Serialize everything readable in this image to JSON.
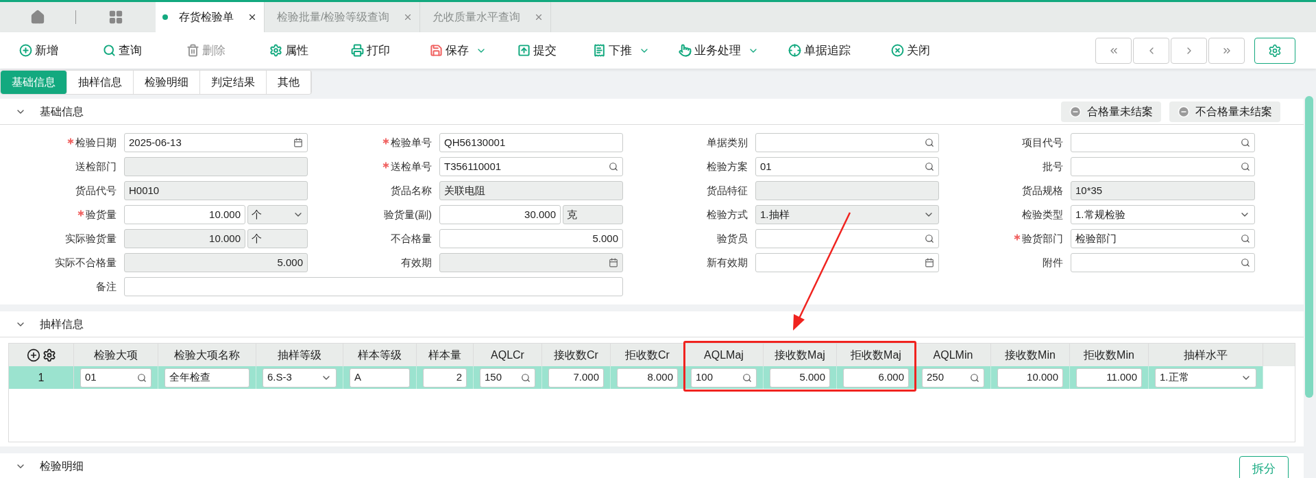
{
  "tabs": [
    {
      "label": "存货检验单",
      "selected": true
    },
    {
      "label": "检验批量/检验等级查询",
      "selected": false
    },
    {
      "label": "允收质量水平查询",
      "selected": false
    }
  ],
  "toolbar": [
    {
      "label": "新增",
      "disabled": false,
      "dropdown": false
    },
    {
      "label": "查询",
      "disabled": false,
      "dropdown": false
    },
    {
      "label": "删除",
      "disabled": true,
      "dropdown": false
    },
    {
      "label": "属性",
      "disabled": false,
      "dropdown": false
    },
    {
      "label": "打印",
      "disabled": false,
      "dropdown": false
    },
    {
      "label": "保存",
      "disabled": false,
      "dropdown": true
    },
    {
      "label": "提交",
      "disabled": false,
      "dropdown": false
    },
    {
      "label": "下推",
      "disabled": false,
      "dropdown": true
    },
    {
      "label": "业务处理",
      "disabled": false,
      "dropdown": true
    },
    {
      "label": "单据追踪",
      "disabled": false,
      "dropdown": false
    },
    {
      "label": "关闭",
      "disabled": false,
      "dropdown": false
    }
  ],
  "sub_tabs": [
    {
      "label": "基础信息",
      "selected": true
    },
    {
      "label": "抽样信息",
      "selected": false
    },
    {
      "label": "检验明细",
      "selected": false
    },
    {
      "label": "判定结果",
      "selected": false
    },
    {
      "label": "其他",
      "selected": false
    }
  ],
  "basic_section": {
    "title": "基础信息",
    "expanded": true,
    "actions": [
      "合格量未结案",
      "不合格量未结案"
    ],
    "form_rows": [
      [
        {
          "label": "检验日期",
          "required": true,
          "kind": "date",
          "value": "2025-06-13",
          "disabled": false
        },
        {
          "label": "检验单号",
          "required": true,
          "kind": "text",
          "value": "QH56130001",
          "disabled": false
        },
        {
          "label": "单据类别",
          "required": false,
          "kind": "search",
          "disabled": false
        },
        {
          "label": "项目代号",
          "required": false,
          "kind": "search",
          "disabled": false
        }
      ],
      [
        {
          "label": "送检部门",
          "required": false,
          "kind": "text",
          "disabled": true
        },
        {
          "label": "送检单号",
          "required": true,
          "kind": "search",
          "value": "T356110001",
          "disabled": false
        },
        {
          "label": "检验方案",
          "required": false,
          "kind": "search",
          "value": "01",
          "disabled": false
        },
        {
          "label": "批号",
          "required": false,
          "kind": "search",
          "disabled": false
        }
      ],
      [
        {
          "label": "货品代号",
          "required": false,
          "kind": "text",
          "value": "H0010",
          "disabled": true
        },
        {
          "label": "货品名称",
          "required": false,
          "kind": "text",
          "value": "关联电阻",
          "disabled": true
        },
        {
          "label": "货品特征",
          "required": false,
          "kind": "text",
          "disabled": true
        },
        {
          "label": "货品规格",
          "required": false,
          "kind": "text",
          "value": "10*35",
          "disabled": true
        }
      ],
      [
        {
          "label": "验货量",
          "required": true,
          "kind": "qty",
          "value": "10.000",
          "disabled": false,
          "unit": {
            "value": "个",
            "kind": "select",
            "disabled": true
          }
        },
        {
          "label": "验货量(副)",
          "required": false,
          "kind": "qty",
          "value": "30.000",
          "disabled": false,
          "unit": {
            "value": "克",
            "kind": "text",
            "disabled": true
          }
        },
        {
          "label": "检验方式",
          "required": false,
          "kind": "select",
          "value": "1.抽样",
          "disabled": true
        },
        {
          "label": "检验类型",
          "required": false,
          "kind": "select",
          "value": "1.常规检验",
          "disabled": false
        }
      ],
      [
        {
          "label": "实际验货量",
          "required": false,
          "kind": "qty",
          "value": "10.000",
          "disabled": true,
          "unit": {
            "value": "个",
            "kind": "text",
            "disabled": true
          }
        },
        {
          "label": "不合格量",
          "required": false,
          "kind": "number",
          "value": "5.000",
          "disabled": false
        },
        {
          "label": "验货员",
          "required": false,
          "kind": "search",
          "disabled": false
        },
        {
          "label": "验货部门",
          "required": true,
          "kind": "search",
          "value": "检验部门",
          "disabled": false
        }
      ],
      [
        {
          "label": "实际不合格量",
          "required": false,
          "kind": "number",
          "value": "5.000",
          "disabled": true
        },
        {
          "label": "有效期",
          "required": false,
          "kind": "date",
          "disabled": true
        },
        {
          "label": "新有效期",
          "required": false,
          "kind": "date",
          "disabled": false
        },
        {
          "label": "附件",
          "required": false,
          "kind": "search",
          "disabled": false
        }
      ],
      [
        {
          "label": "备注",
          "required": false,
          "kind": "note",
          "disabled": false
        }
      ]
    ]
  },
  "sampling_section": {
    "title": "抽样信息",
    "expanded": true,
    "table": {
      "columns": [
        "检验大项",
        "检验大项名称",
        "抽样等级",
        "样本等级",
        "样本量",
        "AQLCr",
        "接收数Cr",
        "拒收数Cr",
        "AQLMaj",
        "接收数Maj",
        "拒收数Maj",
        "AQLMin",
        "接收数Min",
        "拒收数Min",
        "抽样水平"
      ],
      "rows": [
        {
          "number": "1",
          "selected": true,
          "cells": [
            {
              "kind": "search",
              "value": "01"
            },
            {
              "kind": "text",
              "value": "全年检查"
            },
            {
              "kind": "select",
              "value": "6.S-3"
            },
            {
              "kind": "text",
              "value": "A"
            },
            {
              "kind": "number",
              "value": "2"
            },
            {
              "kind": "search",
              "value": "150"
            },
            {
              "kind": "number",
              "value": "7.000"
            },
            {
              "kind": "number",
              "value": "8.000"
            },
            {
              "kind": "search",
              "value": "100"
            },
            {
              "kind": "number",
              "value": "5.000"
            },
            {
              "kind": "number",
              "value": "6.000"
            },
            {
              "kind": "search",
              "value": "250"
            },
            {
              "kind": "number",
              "value": "10.000"
            },
            {
              "kind": "number",
              "value": "11.000"
            },
            {
              "kind": "select",
              "value": "1.正常"
            }
          ]
        }
      ]
    }
  },
  "detail_section": {
    "title": "检验明细",
    "expanded": true,
    "actions": [
      "拆分"
    ]
  }
}
